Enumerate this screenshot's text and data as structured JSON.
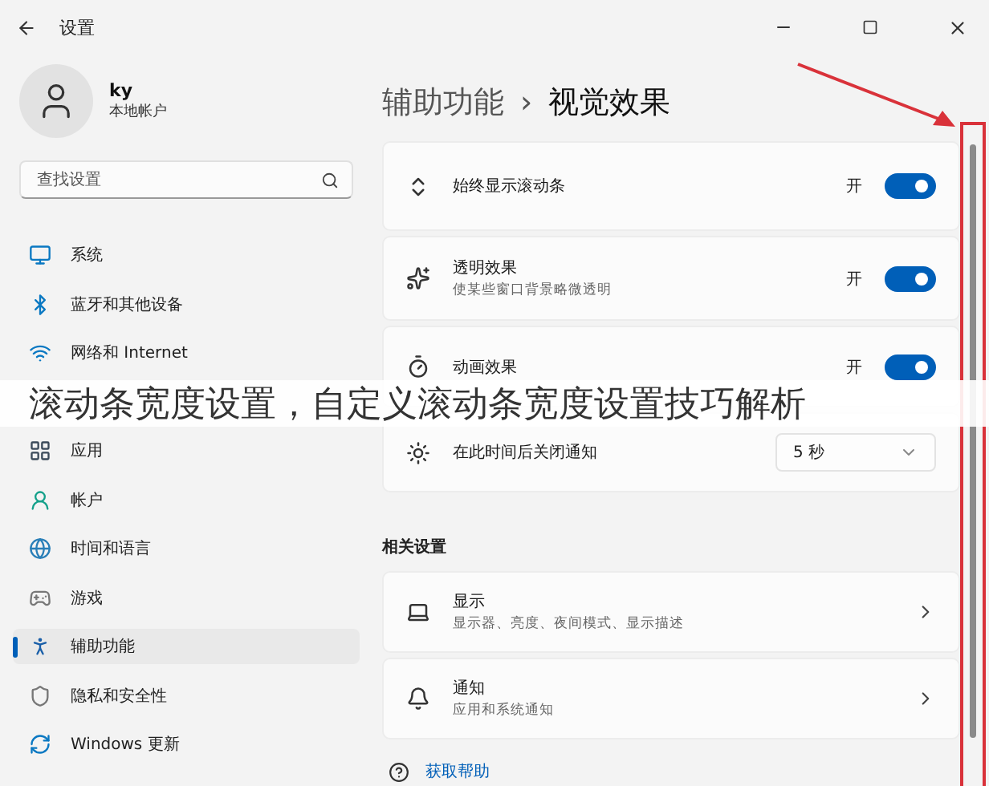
{
  "window": {
    "title": "设置"
  },
  "user": {
    "name": "ky",
    "account": "本地帐户"
  },
  "search": {
    "placeholder": "查找设置"
  },
  "sidebar": {
    "items_above": [
      {
        "label": "系统",
        "selected": false
      },
      {
        "label": "蓝牙和其他设备",
        "selected": false
      },
      {
        "label": "网络和 Internet",
        "selected": false
      }
    ],
    "items_below": [
      {
        "label": "应用",
        "selected": false
      },
      {
        "label": "帐户",
        "selected": false
      },
      {
        "label": "时间和语言",
        "selected": false
      },
      {
        "label": "游戏",
        "selected": false
      },
      {
        "label": "辅助功能",
        "selected": true
      },
      {
        "label": "隐私和安全性",
        "selected": false
      },
      {
        "label": "Windows 更新",
        "selected": false
      }
    ]
  },
  "breadcrumb": {
    "parent": "辅助功能",
    "separator": "›",
    "current": "视觉效果"
  },
  "settings": [
    {
      "kind": "toggle",
      "title": "始终显示滚动条",
      "state_label": "开",
      "on": true
    },
    {
      "kind": "toggle",
      "title": "透明效果",
      "subtitle": "使某些窗口背景略微透明",
      "state_label": "开",
      "on": true
    },
    {
      "kind": "toggle",
      "title": "动画效果",
      "state_label": "开",
      "on": true
    },
    {
      "kind": "dropdown",
      "title": "在此时间后关闭通知",
      "value": "5 秒"
    }
  ],
  "related": {
    "heading": "相关设置",
    "items": [
      {
        "title": "显示",
        "subtitle": "显示器、亮度、夜间模式、显示描述"
      },
      {
        "title": "通知",
        "subtitle": "应用和系统通知"
      }
    ]
  },
  "help_link": "获取帮助",
  "overlay_caption": "滚动条宽度设置，自定义滚动条宽度设置技巧解析"
}
